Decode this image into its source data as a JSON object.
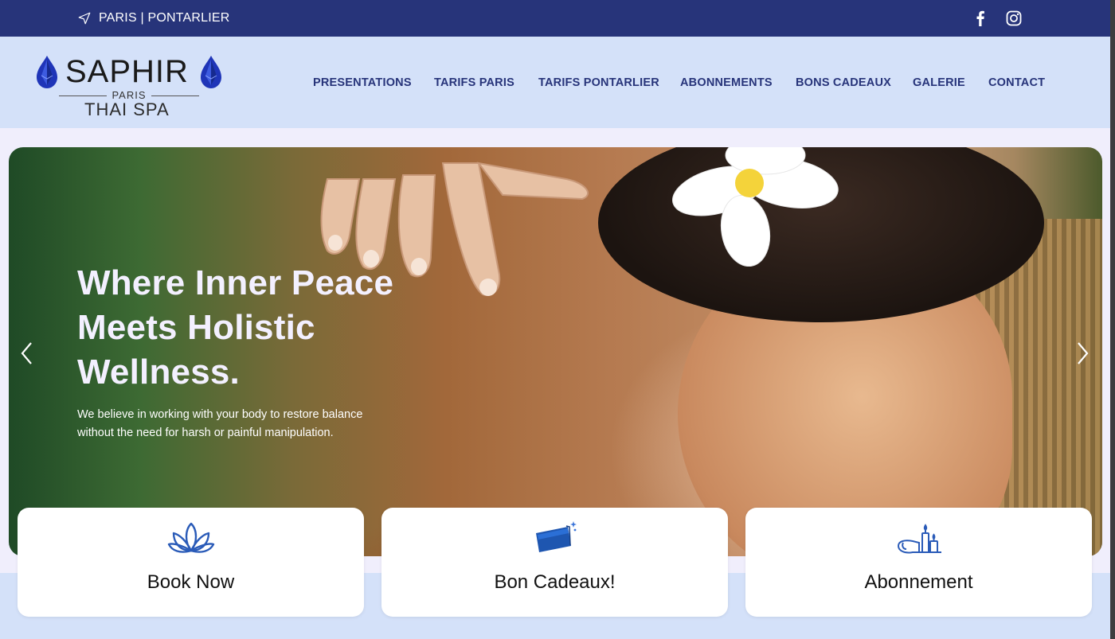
{
  "topbar": {
    "location_text": "PARIS | PONTARLIER",
    "location_icon": "navigation-arrow-icon",
    "social": [
      "facebook-icon",
      "instagram-icon"
    ]
  },
  "header": {
    "logo": {
      "name": "SAPHIR",
      "city": "PARIS",
      "subtitle": "THAI SPA"
    },
    "nav": [
      "PRESENTATIONS",
      "TARIFS PARIS",
      "TARIFS PONTARLIER",
      "ABONNEMENTS",
      "BONS CADEAUX",
      "GALERIE",
      "CONTACT"
    ]
  },
  "hero": {
    "title": "Where Inner Peace Meets Holistic Wellness.",
    "description": "We believe in working with your body to restore balance without the need for harsh or painful manipulation."
  },
  "cards": [
    {
      "label": "Book Now",
      "icon": "lotus-icon"
    },
    {
      "label": "Bon Cadeaux!",
      "icon": "gift-card-icon"
    },
    {
      "label": "Abonnement",
      "icon": "spa-candles-icon"
    }
  ],
  "colors": {
    "topbar": "#27347a",
    "header": "#d4e1f9",
    "nav_text": "#27347a",
    "page_bg": "#f0eefc",
    "icon_blue": "#2a5bb8"
  }
}
